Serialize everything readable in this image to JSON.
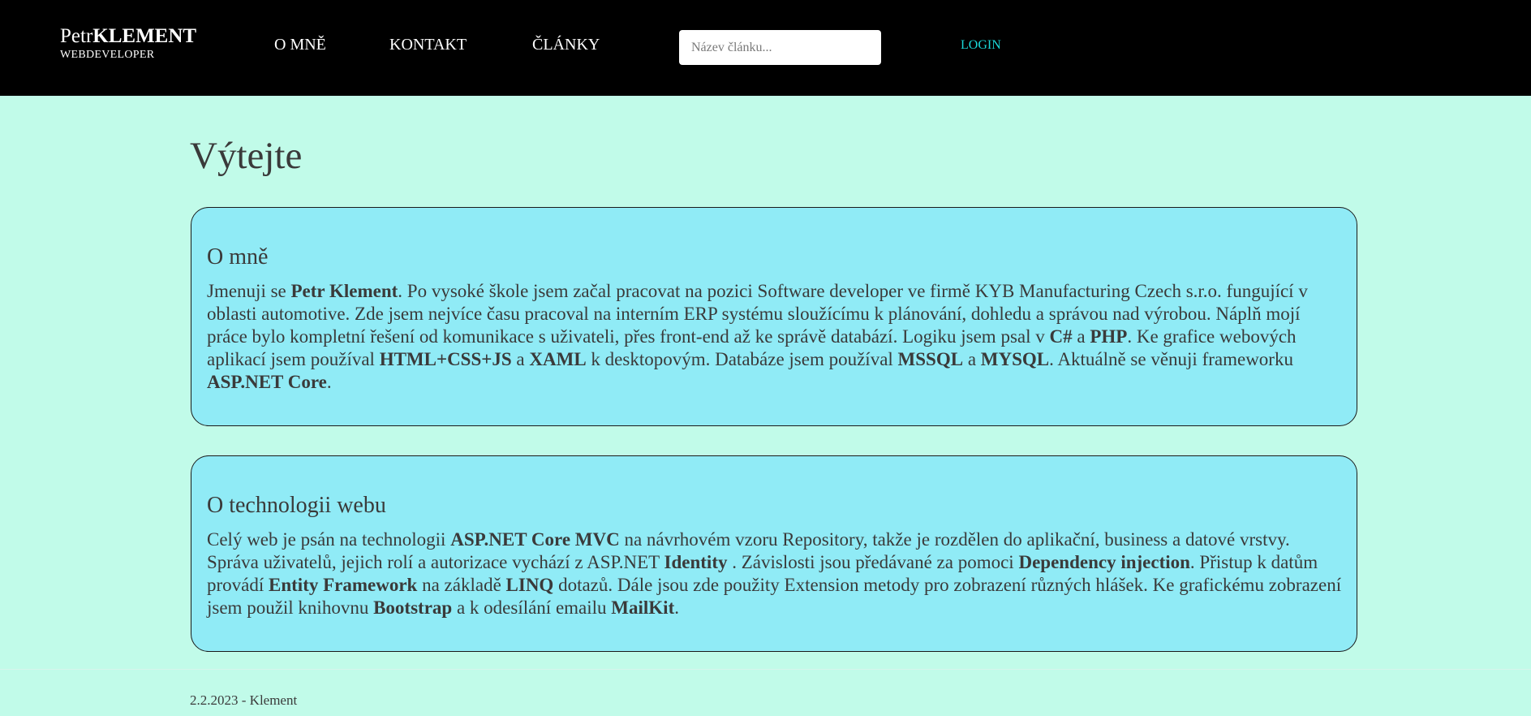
{
  "colors": {
    "navbar_bg": "#000000",
    "page_bg": "#c1fbe9",
    "card_bg": "#90ebf6",
    "login_link": "#1ad7d7",
    "text": "#3a3a3a"
  },
  "brand": {
    "first_name": "Petr",
    "last_name": "KLEMENT",
    "subtitle": "WEBDEVELOPER"
  },
  "nav": {
    "items": [
      {
        "label": "O MNĚ"
      },
      {
        "label": "KONTAKT"
      },
      {
        "label": "ČLÁNKY"
      }
    ],
    "search_placeholder": "Název článku...",
    "login_label": "LOGIN"
  },
  "main": {
    "title": "Výtejte",
    "about": {
      "heading": "O mně",
      "segments": [
        {
          "t": "Jmenuji se "
        },
        {
          "t": "Petr Klement",
          "b": true
        },
        {
          "t": ". Po vysoké škole jsem začal pracovat na pozici Software developer ve firmě KYB Manufacturing Czech s.r.o. fungující v oblasti automotive. Zde jsem nejvíce času pracoval na interním ERP systému sloužícímu k plánování, dohledu a správou nad výrobou. Náplň mojí práce bylo kompletní řešení od komunikace s uživateli, přes front-end až ke správě databází. Logiku jsem psal v "
        },
        {
          "t": "C#",
          "b": true
        },
        {
          "t": " a "
        },
        {
          "t": "PHP",
          "b": true
        },
        {
          "t": ". Ke grafice webových aplikací jsem používal "
        },
        {
          "t": "HTML+CSS+JS",
          "b": true
        },
        {
          "t": " a "
        },
        {
          "t": "XAML",
          "b": true
        },
        {
          "t": " k desktopovým. Databáze jsem používal "
        },
        {
          "t": "MSSQL",
          "b": true
        },
        {
          "t": " a "
        },
        {
          "t": "MYSQL",
          "b": true
        },
        {
          "t": ". Aktuálně se věnuji frameworku "
        },
        {
          "t": "ASP.NET Core",
          "b": true
        },
        {
          "t": "."
        }
      ]
    },
    "tech": {
      "heading": "O technologii webu",
      "segments": [
        {
          "t": "Celý web je psán na technologii "
        },
        {
          "t": "ASP.NET Core MVC",
          "b": true
        },
        {
          "t": " na návrhovém vzoru Repository, takže je rozdělen do aplikační, business a datové vrstvy. Správa uživatelů, jejich rolí a autorizace vychází z ASP.NET "
        },
        {
          "t": "Identity",
          "b": true
        },
        {
          "t": " . Závislosti jsou předávané za pomoci "
        },
        {
          "t": "Dependency injection",
          "b": true
        },
        {
          "t": ". Přistup k datům provádí "
        },
        {
          "t": "Entity Framework",
          "b": true
        },
        {
          "t": " na základě "
        },
        {
          "t": "LINQ",
          "b": true
        },
        {
          "t": " dotazů. Dále jsou zde použity Extension metody pro zobrazení různých hlášek. Ke grafickému zobrazení jsem použil knihovnu "
        },
        {
          "t": "Bootstrap",
          "b": true
        },
        {
          "t": " a k odesílání emailu "
        },
        {
          "t": "MailKit",
          "b": true
        },
        {
          "t": "."
        }
      ]
    }
  },
  "footer": {
    "text": "2.2.2023 - Klement"
  }
}
